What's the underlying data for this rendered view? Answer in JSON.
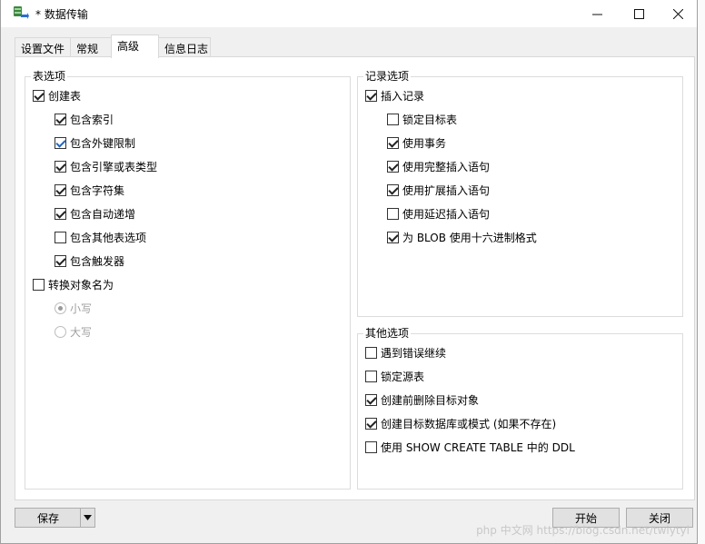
{
  "window": {
    "title": "* 数据传输"
  },
  "tabs": [
    {
      "label": "设置文件"
    },
    {
      "label": "常规"
    },
    {
      "label": "高级"
    },
    {
      "label": "信息日志"
    }
  ],
  "table_options": {
    "title": "表选项",
    "create_table": "创建表",
    "include_index": "包含索引",
    "include_fk": "包含外键限制",
    "include_engine": "包含引擎或表类型",
    "include_charset": "包含字符集",
    "include_autoinc": "包含自动递增",
    "include_other": "包含其他表选项",
    "include_trigger": "包含触发器",
    "convert_name": "转换对象名为",
    "lowercase": "小写",
    "uppercase": "大写"
  },
  "record_options": {
    "title": "记录选项",
    "insert_records": "插入记录",
    "lock_target": "锁定目标表",
    "use_transaction": "使用事务",
    "complete_insert": "使用完整插入语句",
    "extended_insert": "使用扩展插入语句",
    "delayed_insert": "使用延迟插入语句",
    "blob_hex": "为 BLOB 使用十六进制格式"
  },
  "other_options": {
    "title": "其他选项",
    "continue_on_error": "遇到错误继续",
    "lock_source": "锁定源表",
    "drop_before_create": "创建前删除目标对象",
    "create_db": "创建目标数据库或模式 (如果不存在)",
    "show_create_ddl": "使用 SHOW CREATE TABLE 中的 DDL"
  },
  "footer": {
    "save": "保存",
    "start": "开始",
    "close": "关闭",
    "watermark": "php 中文网 https://blog.csdn.net/twiytyl"
  }
}
